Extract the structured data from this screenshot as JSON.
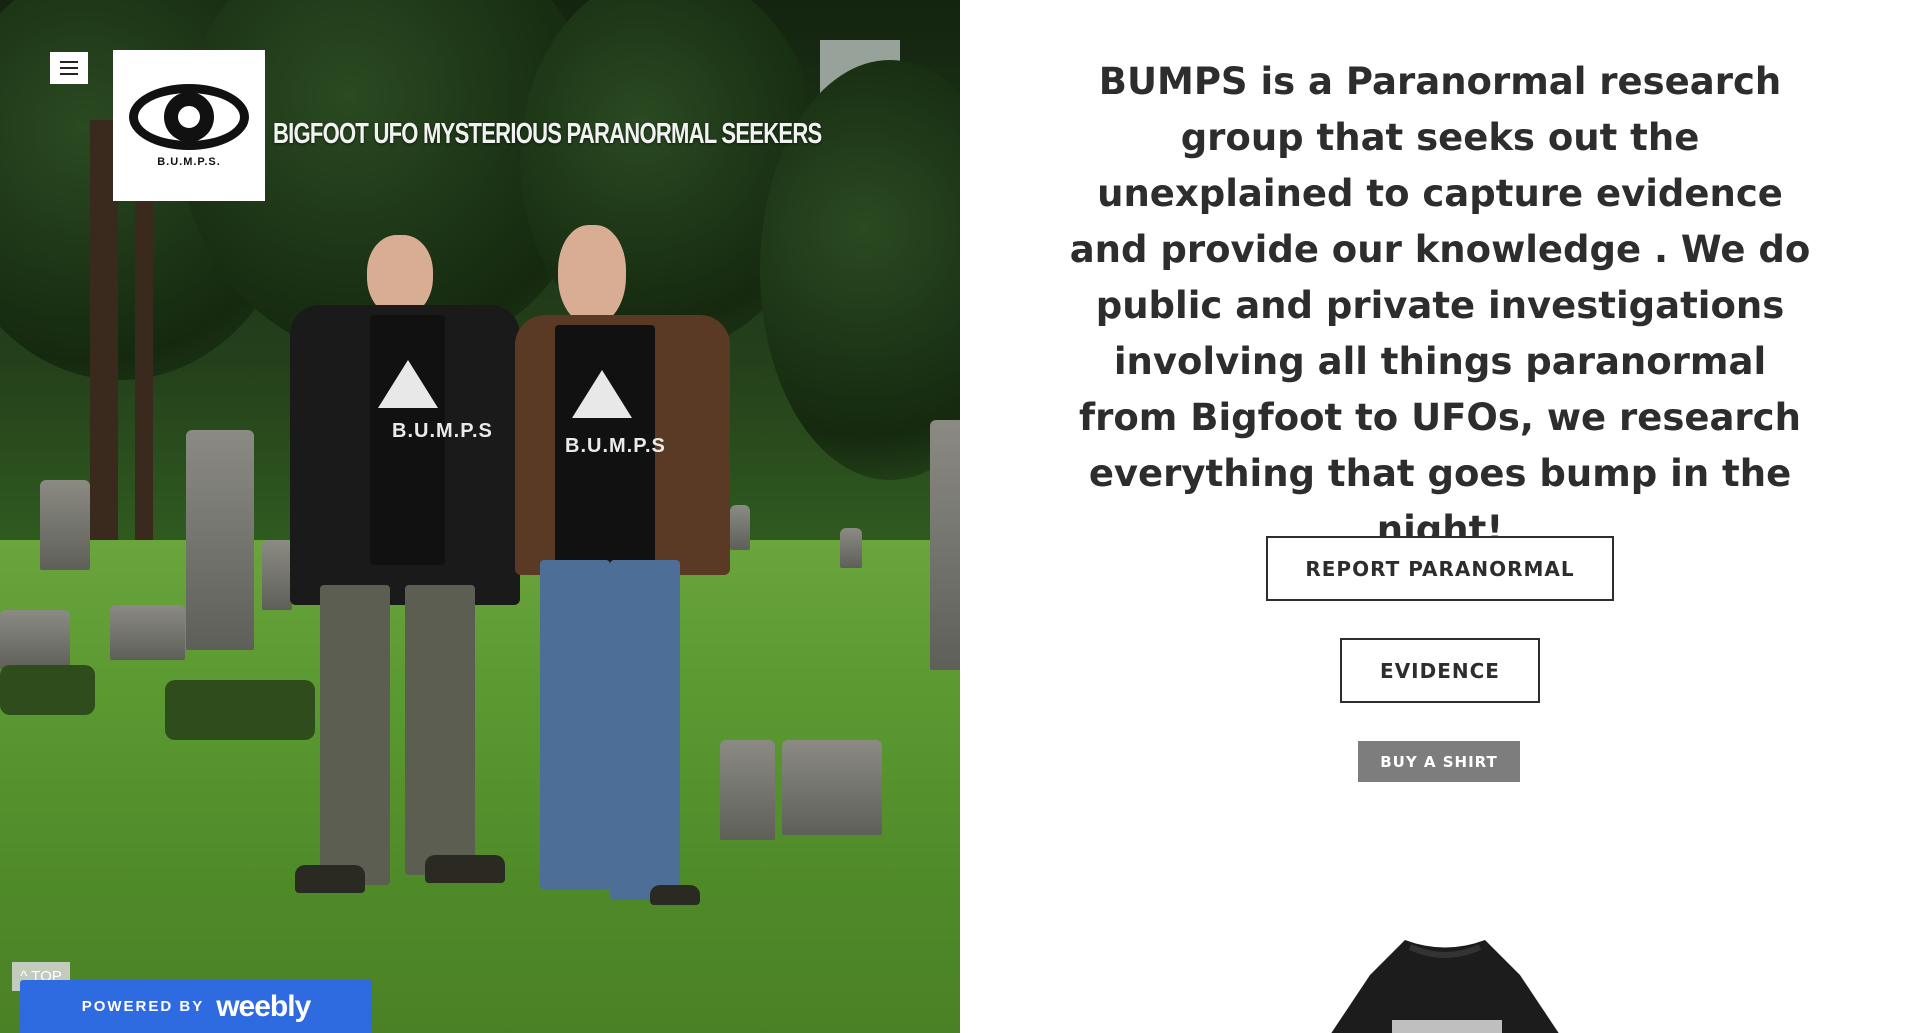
{
  "header": {
    "menu_icon": "hamburger-menu-icon",
    "logo_text": "B.U.M.P.S.",
    "site_title": "BIGFOOT UFO MYSTERIOUS PARANORMAL SEEKERS"
  },
  "hero": {
    "shirt_text_left": "B.U.M.P.S",
    "shirt_text_right": "B.U.M.P.S"
  },
  "main": {
    "intro": "BUMPS is a  Paranormal research group that seeks out the unexplained to capture evidence and provide our knowledge . We do public and private investigations involving all things paranormal from Bigfoot to UFOs, we research everything that goes bump in the night!",
    "buttons": {
      "report": "REPORT PARANORMAL",
      "evidence": "EVIDENCE",
      "shirt": "BUY A SHIRT"
    }
  },
  "footer": {
    "to_top": "^ TOP",
    "powered_by": "POWERED BY",
    "weebly": "weebly"
  },
  "colors": {
    "text": "#2d2d2d",
    "shirt_button": "#7d7d7d",
    "weebly_blue": "#2f6be0"
  }
}
